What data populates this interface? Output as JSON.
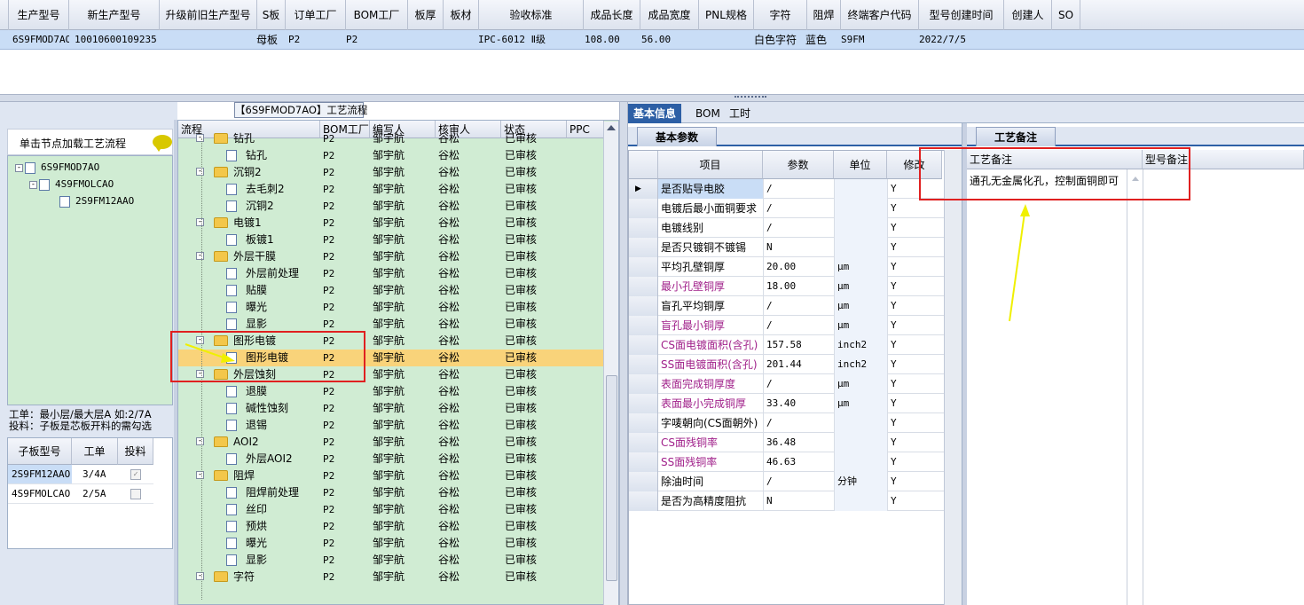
{
  "top_grid": {
    "columns": [
      "生产型号",
      "新生产型号",
      "升级前旧生产型号",
      "S板",
      "订单工厂",
      "BOM工厂",
      "板厚",
      "板材",
      "验收标准",
      "成品长度",
      "成品宽度",
      "PNL规格",
      "字符",
      "阻焊",
      "终端客户代码",
      "型号创建时间",
      "创建人",
      "SO"
    ],
    "row": [
      "6S9FMOD7AO",
      "10010600109235",
      "",
      "母板",
      "P2",
      "P2",
      "",
      "",
      "IPC-6012 Ⅱ级",
      "108.00",
      "56.00",
      "",
      "白色字符",
      "蓝色",
      "S9FM",
      "2022/7/5",
      "",
      ""
    ]
  },
  "left_pane": {
    "click_label": "单击节点加载工艺流程",
    "tree": [
      "6S9FMOD7AO",
      "4S9FMOLCAO",
      "2S9FM12AAO"
    ],
    "hint_line1": "工单：最小层/最大层A 如:2/7A",
    "hint_line2": "投料：子板是芯板开料的需勾选",
    "sub_grid": {
      "headers": [
        "子板型号",
        "工单",
        "投料"
      ],
      "rows": [
        {
          "model": "2S9FM12AAO",
          "order": "3/4A",
          "feed": "✓"
        },
        {
          "model": "4S9FMOLCAO",
          "order": "2/5A",
          "feed": ""
        }
      ]
    }
  },
  "process": {
    "title": "【6S9FMOD7AO】工艺流程",
    "headers": [
      "流程",
      "BOM工厂",
      "编写人",
      "核审人",
      "状态",
      "PPC"
    ],
    "rows": [
      {
        "name": "钻孔",
        "level": 0,
        "bom": "P2",
        "writer": "邹宇航",
        "reviewer": "谷松",
        "status": "已审核"
      },
      {
        "name": "钻孔",
        "level": 1,
        "bom": "P2",
        "writer": "邹宇航",
        "reviewer": "谷松",
        "status": "已审核"
      },
      {
        "name": "沉铜2",
        "level": 0,
        "bom": "P2",
        "writer": "邹宇航",
        "reviewer": "谷松",
        "status": "已审核"
      },
      {
        "name": "去毛刺2",
        "level": 1,
        "bom": "P2",
        "writer": "邹宇航",
        "reviewer": "谷松",
        "status": "已审核"
      },
      {
        "name": "沉铜2",
        "level": 1,
        "bom": "P2",
        "writer": "邹宇航",
        "reviewer": "谷松",
        "status": "已审核"
      },
      {
        "name": "电镀1",
        "level": 0,
        "bom": "P2",
        "writer": "邹宇航",
        "reviewer": "谷松",
        "status": "已审核"
      },
      {
        "name": "板镀1",
        "level": 1,
        "bom": "P2",
        "writer": "邹宇航",
        "reviewer": "谷松",
        "status": "已审核"
      },
      {
        "name": "外层干膜",
        "level": 0,
        "bom": "P2",
        "writer": "邹宇航",
        "reviewer": "谷松",
        "status": "已审核"
      },
      {
        "name": "外层前处理",
        "level": 1,
        "bom": "P2",
        "writer": "邹宇航",
        "reviewer": "谷松",
        "status": "已审核"
      },
      {
        "name": "贴膜",
        "level": 1,
        "bom": "P2",
        "writer": "邹宇航",
        "reviewer": "谷松",
        "status": "已审核"
      },
      {
        "name": "曝光",
        "level": 1,
        "bom": "P2",
        "writer": "邹宇航",
        "reviewer": "谷松",
        "status": "已审核"
      },
      {
        "name": "显影",
        "level": 1,
        "bom": "P2",
        "writer": "邹宇航",
        "reviewer": "谷松",
        "status": "已审核"
      },
      {
        "name": "图形电镀",
        "level": 0,
        "bom": "P2",
        "writer": "邹宇航",
        "reviewer": "谷松",
        "status": "已审核"
      },
      {
        "name": "图形电镀",
        "level": 1,
        "bom": "P2",
        "writer": "邹宇航",
        "reviewer": "谷松",
        "status": "已审核",
        "selected": true
      },
      {
        "name": "外层蚀刻",
        "level": 0,
        "bom": "P2",
        "writer": "邹宇航",
        "reviewer": "谷松",
        "status": "已审核"
      },
      {
        "name": "退膜",
        "level": 1,
        "bom": "P2",
        "writer": "邹宇航",
        "reviewer": "谷松",
        "status": "已审核"
      },
      {
        "name": "碱性蚀刻",
        "level": 1,
        "bom": "P2",
        "writer": "邹宇航",
        "reviewer": "谷松",
        "status": "已审核"
      },
      {
        "name": "退锡",
        "level": 1,
        "bom": "P2",
        "writer": "邹宇航",
        "reviewer": "谷松",
        "status": "已审核"
      },
      {
        "name": "AOI2",
        "level": 0,
        "bom": "P2",
        "writer": "邹宇航",
        "reviewer": "谷松",
        "status": "已审核"
      },
      {
        "name": "外层AOI2",
        "level": 1,
        "bom": "P2",
        "writer": "邹宇航",
        "reviewer": "谷松",
        "status": "已审核"
      },
      {
        "name": "阻焊",
        "level": 0,
        "bom": "P2",
        "writer": "邹宇航",
        "reviewer": "谷松",
        "status": "已审核"
      },
      {
        "name": "阻焊前处理",
        "level": 1,
        "bom": "P2",
        "writer": "邹宇航",
        "reviewer": "谷松",
        "status": "已审核"
      },
      {
        "name": "丝印",
        "level": 1,
        "bom": "P2",
        "writer": "邹宇航",
        "reviewer": "谷松",
        "status": "已审核"
      },
      {
        "name": "预烘",
        "level": 1,
        "bom": "P2",
        "writer": "邹宇航",
        "reviewer": "谷松",
        "status": "已审核"
      },
      {
        "name": "曝光",
        "level": 1,
        "bom": "P2",
        "writer": "邹宇航",
        "reviewer": "谷松",
        "status": "已审核"
      },
      {
        "name": "显影",
        "level": 1,
        "bom": "P2",
        "writer": "邹宇航",
        "reviewer": "谷松",
        "status": "已审核"
      },
      {
        "name": "字符",
        "level": 0,
        "bom": "P2",
        "writer": "邹宇航",
        "reviewer": "谷松",
        "status": "已审核"
      }
    ]
  },
  "tabs": [
    "基本信息",
    "BOM",
    "工时"
  ],
  "params": {
    "tab_label": "基本参数",
    "headers": [
      "项目",
      "参数",
      "单位",
      "修改"
    ],
    "rows": [
      {
        "item": "是否贴导电胶",
        "value": "/",
        "unit": "",
        "mod": "Y",
        "purple": false
      },
      {
        "item": "电镀后最小面铜要求",
        "value": "/",
        "unit": "",
        "mod": "Y",
        "purple": false
      },
      {
        "item": "电镀线别",
        "value": "/",
        "unit": "",
        "mod": "Y",
        "purple": false
      },
      {
        "item": "是否只镀铜不镀锡",
        "value": "N",
        "unit": "",
        "mod": "Y",
        "purple": false
      },
      {
        "item": "平均孔壁铜厚",
        "value": "20.00",
        "unit": "μm",
        "mod": "Y",
        "purple": false
      },
      {
        "item": "最小孔壁铜厚",
        "value": "18.00",
        "unit": "μm",
        "mod": "Y",
        "purple": true
      },
      {
        "item": "盲孔平均铜厚",
        "value": "/",
        "unit": "μm",
        "mod": "Y",
        "purple": false
      },
      {
        "item": "盲孔最小铜厚",
        "value": "/",
        "unit": "μm",
        "mod": "Y",
        "purple": true
      },
      {
        "item": "CS面电镀面积(含孔)",
        "value": "157.58",
        "unit": "inch2",
        "mod": "Y",
        "purple": true
      },
      {
        "item": "SS面电镀面积(含孔)",
        "value": "201.44",
        "unit": "inch2",
        "mod": "Y",
        "purple": true
      },
      {
        "item": "表面完成铜厚度",
        "value": "/",
        "unit": "μm",
        "mod": "Y",
        "purple": true
      },
      {
        "item": "表面最小完成铜厚",
        "value": "33.40",
        "unit": "μm",
        "mod": "Y",
        "purple": true
      },
      {
        "item": "字唛朝向(CS面朝外)",
        "value": "/",
        "unit": "",
        "mod": "Y",
        "purple": false
      },
      {
        "item": "CS面残铜率",
        "value": "36.48",
        "unit": "",
        "mod": "Y",
        "purple": true
      },
      {
        "item": "SS面残铜率",
        "value": "46.63",
        "unit": "",
        "mod": "Y",
        "purple": true
      },
      {
        "item": "除油时间",
        "value": "/",
        "unit": "分钟",
        "mod": "Y",
        "purple": false
      },
      {
        "item": "是否为高精度阻抗",
        "value": "N",
        "unit": "",
        "mod": "Y",
        "purple": false
      }
    ]
  },
  "notes": {
    "tab_label": "工艺备注",
    "headers": [
      "工艺备注",
      "型号备注"
    ],
    "content": "通孔无金属化孔，控制面铜即可"
  },
  "colors": {
    "accent": "#2d5fa5",
    "tree_bg": "#d0ecd3",
    "selected_row": "#f9d37a",
    "highlight": "#e02020",
    "arrow": "#f0f000"
  }
}
